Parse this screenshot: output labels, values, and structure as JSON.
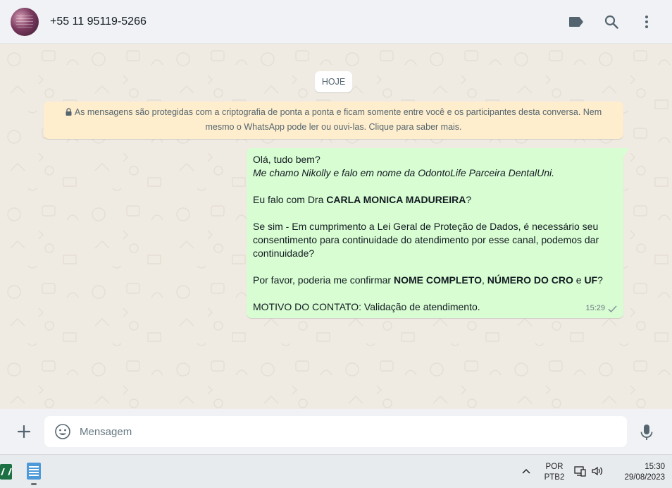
{
  "header": {
    "contact_name": "+55 11 95119-5266",
    "icons": [
      "label-icon",
      "search-icon",
      "menu-icon"
    ]
  },
  "chat": {
    "date_chip": "HOJE",
    "encryption_notice": "As mensagens são protegidas com a criptografia de ponta a ponta e ficam somente entre você e os participantes desta conversa. Nem mesmo o WhatsApp pode ler ou ouvi-las. Clique para saber mais.",
    "message": {
      "line1": "Olá, tudo bem?",
      "line2": "Me chamo Nikolly e falo em nome da OdontoLife Parceira DentalUni.",
      "line3_pre": "Eu falo com Dra ",
      "line3_bold": "CARLA MONICA MADUREIRA",
      "line3_post": "?",
      "para3": "Se sim - Em cumprimento a Lei Geral de Proteção de Dados, é necessário seu consentimento para continuidade do atendimento por esse canal, podemos dar continuidade?",
      "para4_pre": "Por favor, poderia me confirmar ",
      "para4_b1": "NOME COMPLETO",
      "para4_sep": ", ",
      "para4_b2": "NÚMERO DO CRO",
      "para4_and": " e ",
      "para4_b3": "UF",
      "para4_post": "?",
      "para5": "MOTIVO DO CONTATO: Validação de atendimento.",
      "time": "15:29",
      "status": "sent"
    }
  },
  "composer": {
    "placeholder": "Mensagem",
    "value": ""
  },
  "taskbar": {
    "apps": [
      "excel-app",
      "notepad-app"
    ],
    "lang_line1": "POR",
    "lang_line2": "PTB2",
    "time": "15:30",
    "date": "29/08/2023"
  },
  "colors": {
    "chat_bg": "#efeae2",
    "bubble_out": "#d9fdd3",
    "notice_bg": "#ffeecd",
    "header_bg": "#f0f2f5",
    "icon": "#54656f"
  }
}
